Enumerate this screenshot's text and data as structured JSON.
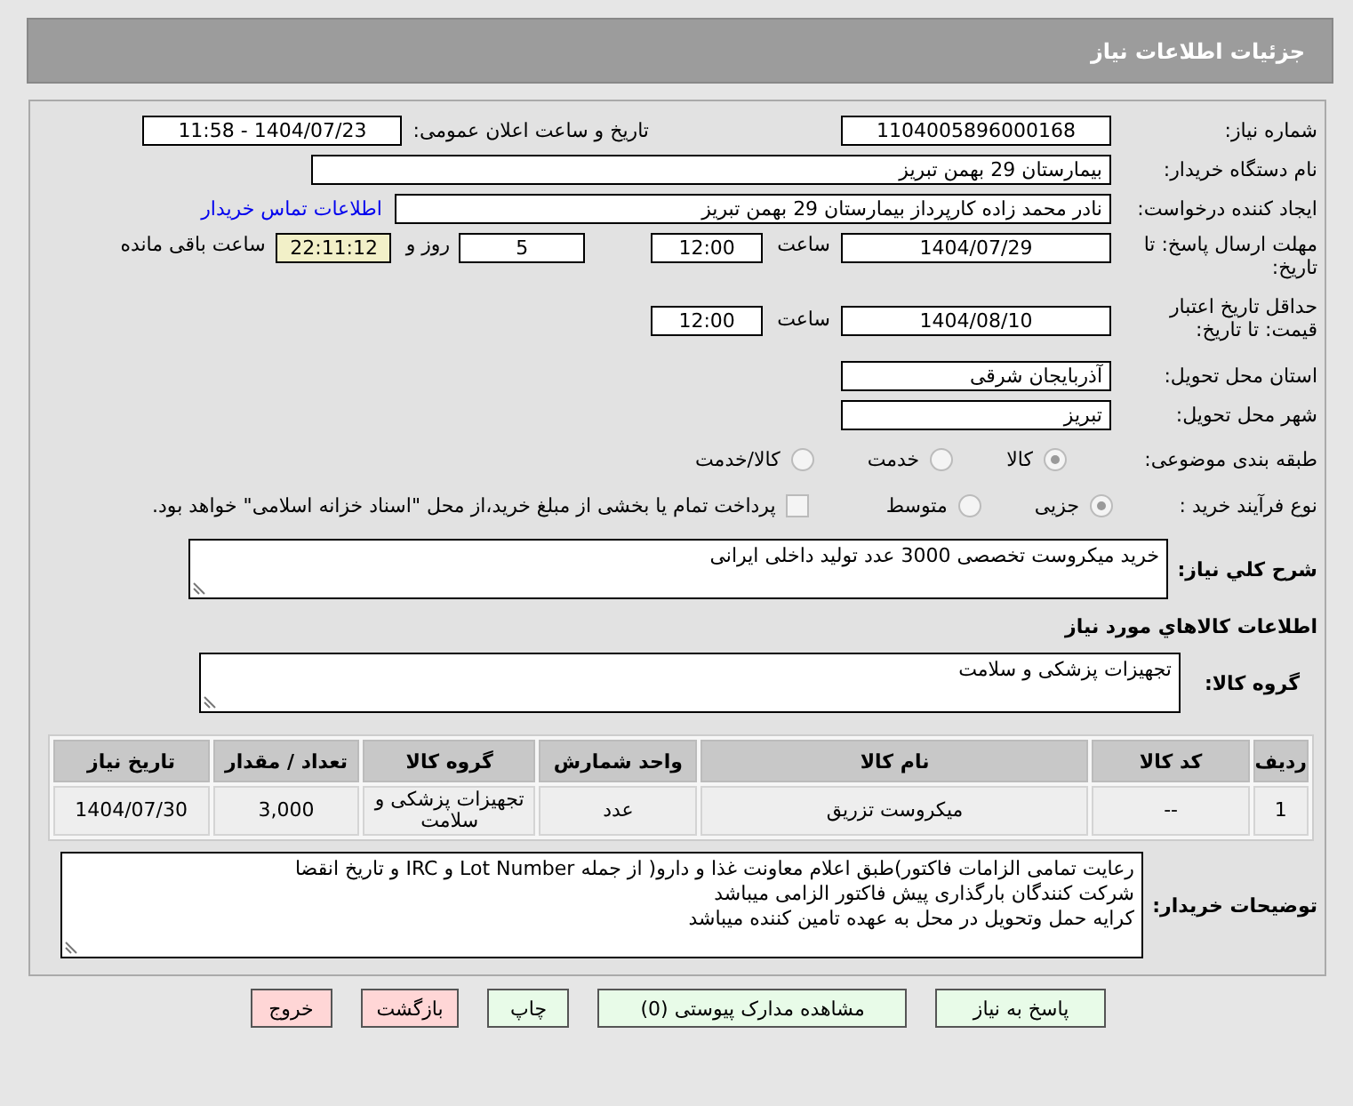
{
  "header": {
    "title": "جزئیات اطلاعات نیاز"
  },
  "need_number": {
    "label": "شماره نیاز:",
    "value": "1104005896000168"
  },
  "announce": {
    "label": "تاریخ و ساعت اعلان عمومی:",
    "value": "1404/07/23 - 11:58"
  },
  "buyer": {
    "label": "نام دستگاه خریدار:",
    "value": "بیمارستان 29 بهمن تبریز"
  },
  "requester": {
    "label": "ایجاد کننده درخواست:",
    "value": "نادر محمد زاده کارپرداز بیمارستان 29 بهمن تبریز",
    "link": "اطلاعات تماس خریدار"
  },
  "deadline": {
    "label": "مهلت ارسال پاسخ: تا تاریخ:",
    "date": "1404/07/29",
    "time_label": "ساعت",
    "time": "12:00",
    "days": "5",
    "days_label": "روز و",
    "remaining": "22:11:12",
    "remaining_label": "ساعت باقی مانده"
  },
  "validity": {
    "label": "حداقل تاریخ اعتبار قیمت: تا تاریخ:",
    "date": "1404/08/10",
    "time_label": "ساعت",
    "time": "12:00"
  },
  "province": {
    "label": "استان محل تحویل:",
    "value": "آذربایجان شرقی"
  },
  "city": {
    "label": "شهر محل تحویل:",
    "value": "تبریز"
  },
  "category": {
    "label": "طبقه بندی موضوعی:",
    "options": [
      {
        "label": "کالا",
        "selected": true
      },
      {
        "label": "خدمت",
        "selected": false
      },
      {
        "label": "کالا/خدمت",
        "selected": false
      }
    ]
  },
  "process": {
    "label": "نوع فرآیند خرید :",
    "options": [
      {
        "label": "جزیی",
        "selected": true
      },
      {
        "label": "متوسط",
        "selected": false
      }
    ],
    "payment": {
      "label": "پرداخت تمام یا بخشی از مبلغ خرید،از محل \"اسناد خزانه اسلامی\" خواهد بود.",
      "checked": false
    }
  },
  "description": {
    "label": "شرح کلي نياز:",
    "value": "خرید میکروست تخصصی 3000  عدد تولید داخلی ایرانی"
  },
  "goods_title": "اطلاعات کالاهاي مورد نياز",
  "goods_group": {
    "label": "گروه کالا:",
    "value": "تجهیزات پزشکی و سلامت"
  },
  "table": {
    "columns": [
      "ردیف",
      "کد کالا",
      "نام کالا",
      "واحد شمارش",
      "گروه کالا",
      "تعداد / مقدار",
      "تاریخ نیاز"
    ],
    "rows": [
      [
        "1",
        "--",
        "میکروست تزریق",
        "عدد",
        "تجهیزات پزشکی و سلامت",
        "3,000",
        "1404/07/30"
      ]
    ]
  },
  "notes": {
    "label": "توضیحات خریدار:",
    "lines": [
      "رعایت تمامی الزامات فاکتور)طبق اعلام معاونت غذا و دارو( از جمله Lot Number و IRC و تاریخ انقضا",
      "شرکت کنندگان بارگذاری پیش فاکتور الزامی میباشد",
      "کرایه حمل وتحویل در محل به عهده تامین کننده میباشد"
    ]
  },
  "buttons": [
    {
      "label": "پاسخ به نیاز",
      "kind": "green"
    },
    {
      "label": "مشاهده مدارک پیوستی (0)",
      "kind": "green"
    },
    {
      "label": "چاپ",
      "kind": "green"
    },
    {
      "label": "بازگشت",
      "kind": "pink"
    },
    {
      "label": "خروج",
      "kind": "pink"
    }
  ]
}
